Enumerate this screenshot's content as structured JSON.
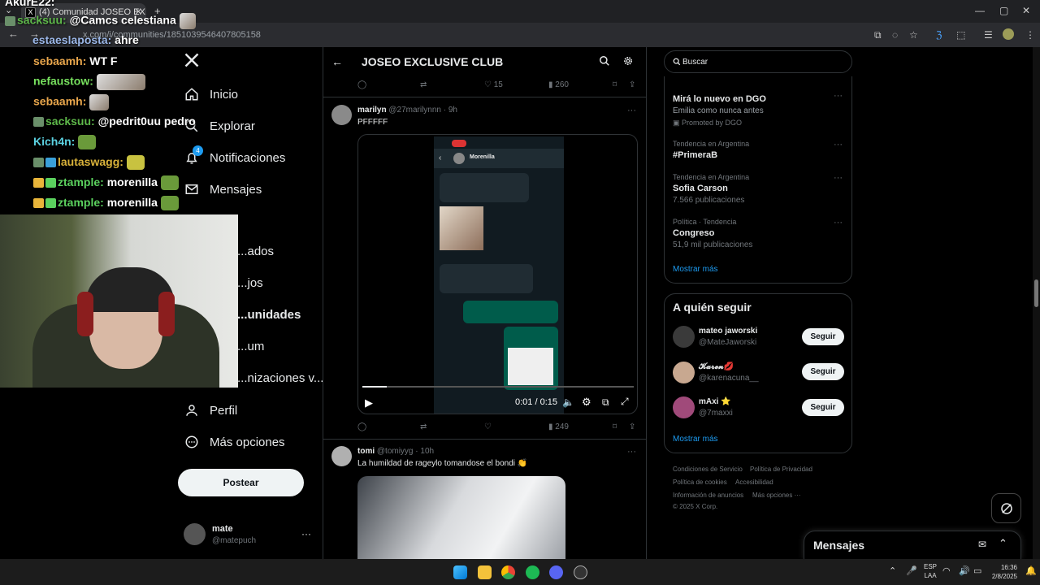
{
  "browser": {
    "tab_title": "(4) Comunidad JOSEO EX...",
    "url": "x.com/i/communities/1851039546407805158"
  },
  "chat": {
    "lines": [
      {
        "user": "AkurE22:",
        "msg": "",
        "color": "#ffffff"
      },
      {
        "user": "sacksuu:",
        "msg": "@Camcs celestiana",
        "color": "#5eb84a"
      },
      {
        "user": "estaeslaposta:",
        "msg": "ahre",
        "color": "#9bb7e8"
      },
      {
        "user": "sebaamh:",
        "msg": "WT F",
        "color": "#e8a64c"
      },
      {
        "user": "nefaustow:",
        "msg": "",
        "color": "#77e05e"
      },
      {
        "user": "sebaamh:",
        "msg": "",
        "color": "#e8a64c"
      },
      {
        "user": "sacksuu:",
        "msg": "@pedrit0uu pedro",
        "color": "#5eb84a"
      },
      {
        "user": "Kich4n:",
        "msg": "",
        "color": "#5bd1e0"
      },
      {
        "user": "lautaswagg:",
        "msg": "",
        "color": "#d9b23a"
      },
      {
        "user": "ztample:",
        "msg": "morenilla",
        "color": "#5bd15e"
      },
      {
        "user": "ztample:",
        "msg": "morenilla",
        "color": "#5bd15e"
      }
    ]
  },
  "leftnav": {
    "items": [
      {
        "label": "Inicio",
        "icon": "home-icon"
      },
      {
        "label": "Explorar",
        "icon": "search-icon"
      },
      {
        "label": "Notificaciones",
        "icon": "bell-icon",
        "badge": "4"
      },
      {
        "label": "Mensajes",
        "icon": "mail-icon"
      },
      {
        "label": "...ados",
        "icon": ""
      },
      {
        "label": "...jos",
        "icon": ""
      },
      {
        "label": "...unidades",
        "icon": ""
      },
      {
        "label": "...um",
        "icon": ""
      },
      {
        "label": "...nizaciones v...",
        "icon": ""
      },
      {
        "label": "Perfil",
        "icon": "person-icon"
      },
      {
        "label": "Más opciones",
        "icon": "more-circle-icon"
      }
    ],
    "post_button": "Postear",
    "account": {
      "name": "mate",
      "handle": "@matepuch"
    }
  },
  "header": {
    "title": "JOSEO EXCLUSIVE CLUB"
  },
  "posts": [
    {
      "actions": {
        "likes": "15",
        "views": "260"
      }
    },
    {
      "name": "marilyn",
      "handle": "@27marilynnn",
      "time": "· 9h",
      "text": "PFFFFF",
      "chat_contact": "Morenilla",
      "video_time": "0:01 / 0:15",
      "progress": 0.09,
      "actions": {
        "views": "249"
      }
    },
    {
      "name": "tomi",
      "handle": "@tomiyyg",
      "time": "· 10h",
      "text": "La humildad de rageylo tomandose el bondi"
    }
  ],
  "search": {
    "placeholder": "Buscar"
  },
  "trends": {
    "promoted": {
      "title": "Mirá lo nuevo en DGO",
      "sub": "Emilia como nunca antes",
      "meta": "Promoted by DGO"
    },
    "items": [
      {
        "meta": "Tendencia en Argentina",
        "title": "#PrimeraB",
        "sub": ""
      },
      {
        "meta": "Tendencia en Argentina",
        "title": "Sofia Carson",
        "sub": "7.566 publicaciones"
      },
      {
        "meta": "Política · Tendencia",
        "title": "Congreso",
        "sub": "51,9 mil publicaciones"
      }
    ],
    "show_more": "Mostrar más"
  },
  "who_to_follow": {
    "title": "A quién seguir",
    "accounts": [
      {
        "name": "mateo jaworski",
        "handle": "@MateJaworski"
      },
      {
        "name": "𝓚𝓪𝓻𝓮𝓷💋",
        "handle": "@karenacuna__"
      },
      {
        "name": "mAxi ⭐",
        "handle": "@7maxxi"
      }
    ],
    "follow_label": "Seguir",
    "show_more": "Mostrar más"
  },
  "footer": {
    "links": [
      "Condiciones de Servicio",
      "Política de Privacidad",
      "Política de cookies",
      "Accesibilidad",
      "Información de anuncios",
      "Más opciones ···"
    ],
    "copyright": "© 2025 X Corp."
  },
  "messages_drawer": {
    "title": "Mensajes"
  },
  "taskbar": {
    "lang": "ESP",
    "lang2": "LAA",
    "time": "16:36",
    "date": "2/8/2025"
  },
  "colors": {
    "accent": "#1d9bf0",
    "bg": "#000000",
    "border": "#2f3336",
    "muted": "#71767b"
  }
}
